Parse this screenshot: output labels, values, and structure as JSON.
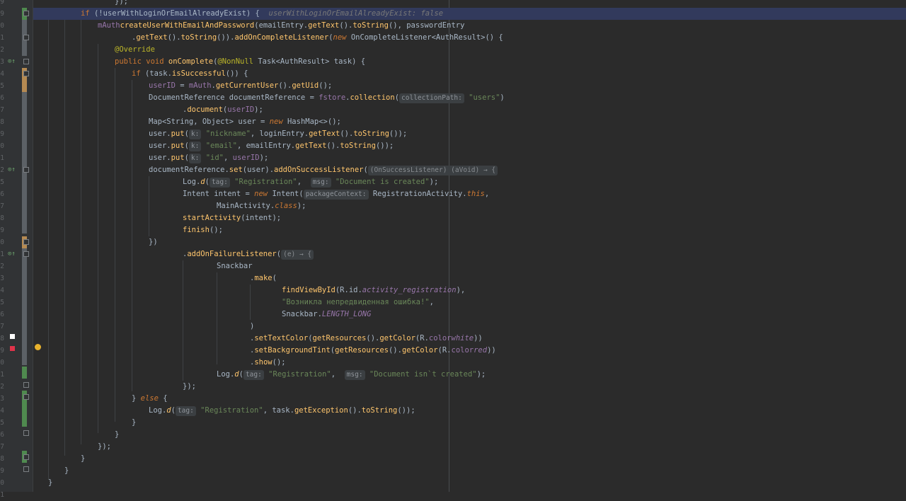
{
  "gutter": {
    "line_numbers": [
      "9",
      "9",
      "0",
      "1",
      "2",
      "3",
      "4",
      "5",
      "6",
      "7",
      "8",
      "9",
      "0",
      "1",
      "2",
      "5",
      "6",
      "7",
      "8",
      "9",
      "0",
      "1",
      "2",
      "3",
      "4",
      "5",
      "6",
      "7",
      "8",
      "9",
      "0",
      "1",
      "2",
      "3",
      "4",
      "5",
      "6",
      "7",
      "8",
      "9",
      "0",
      "1"
    ]
  },
  "colors": {
    "background": "#2b2b2b",
    "current_line": "#323a5c",
    "keyword": "#cc7832",
    "string": "#6a8759",
    "field": "#9876aa",
    "method": "#ffc66d",
    "annotation": "#bbb529",
    "swatch_white": "#ffffff",
    "swatch_red": "#e0334a"
  },
  "code": {
    "l0": "});",
    "l1": {
      "a": "if",
      "b": " (!userWithLoginOrEmailAlreadyExist) {",
      "hint": "userWithLoginOrEmailAlreadyExist: false"
    },
    "l2": {
      "a": "mAuth",
      ".": ".",
      "b": "createUserWithEmailAndPassword",
      "c": "(emailEntry.",
      "d": "getText",
      "e": "().",
      "f": "toString",
      "g": "(), passwordEntry"
    },
    "l3": {
      "a": ".",
      "b": "getText",
      "c": "().",
      "d": "toString",
      "e": "()).",
      "f": "addOnCompleteListener",
      "g": "(",
      "h": "new",
      "i": " OnCompleteListener<AuthResult>() {"
    },
    "l4": "@Override",
    "l5": {
      "a": "public void",
      "b": " ",
      "c": "onComplete",
      "d": "(",
      "e": "@NonNull",
      "f": " Task<AuthResult> task) {"
    },
    "l6": {
      "a": "if",
      "b": " (task.",
      "c": "isSuccessful",
      "d": "()) {"
    },
    "l7": {
      "a": "userID",
      "b": " = ",
      "c": "mAuth",
      "d": ".",
      "e": "getCurrentUser",
      "f": "().",
      "g": "getUid",
      "h": "();"
    },
    "l8": {
      "a": "DocumentReference documentReference = ",
      "b": "fstore",
      "c": ".",
      "d": "collection",
      "e": "(",
      "ph": "collectionPath:",
      "f": " ",
      "g": "\"users\"",
      "h": ")"
    },
    "l9": {
      "a": ".",
      "b": "document",
      "c": "(",
      "d": "userID",
      "e": ");"
    },
    "l10": {
      "a": "Map<String, Object> user = ",
      "b": "new",
      "c": " HashMap<>();"
    },
    "l11": {
      "a": "user.",
      "b": "put",
      "c": "(",
      "ph": "k:",
      "d": " ",
      "e": "\"nickname\"",
      "f": ", loginEntry.",
      "g": "getText",
      "h": "().",
      "i": "toString",
      "j": "());"
    },
    "l12": {
      "a": "user.",
      "b": "put",
      "c": "(",
      "ph": "k:",
      "d": " ",
      "e": "\"email\"",
      "f": ", emailEntry.",
      "g": "getText",
      "h": "().",
      "i": "toString",
      "j": "());"
    },
    "l13": {
      "a": "user.",
      "b": "put",
      "c": "(",
      "ph": "k:",
      "d": " ",
      "e": "\"id\"",
      "f": ", ",
      "g": "userID",
      "h": ");"
    },
    "l14": {
      "a": "documentReference.",
      "b": "set",
      "c": "(user).",
      "d": "addOnSuccessListener",
      "e": "(",
      "lam": "(OnSuccessListener) (aVoid) → {"
    },
    "l15": {
      "a": "Log.",
      "b": "d",
      "c": "(",
      "ph1": "tag:",
      "d": " ",
      "e": "\"Registration\"",
      "f": ",  ",
      "ph2": "msg:",
      "g": " ",
      "h": "\"Document is created\"",
      "i": ");"
    },
    "l16": {
      "a": "Intent intent = ",
      "b": "new",
      "c": " Intent(",
      "ph": "packageContext:",
      "d": " RegistrationActivity.",
      "e": "this",
      ",": ","
    },
    "l17": {
      "a": "MainActivity.",
      "b": "class",
      "c": ");"
    },
    "l18": {
      "a": "startActivity",
      "b": "(intent);"
    },
    "l19": {
      "a": "finish",
      "b": "();"
    },
    "l20": "})",
    "l21": {
      "a": ".",
      "b": "addOnFailureListener",
      "c": "(",
      "lam": "(e) → {"
    },
    "l22": "Snackbar",
    "l23": {
      "a": ".",
      "b": "make",
      "c": "("
    },
    "l24": {
      "a": "findViewById",
      "b": "(R.id.",
      "c": "activity_registration",
      "d": "),"
    },
    "l25": {
      "a": "\"Возникла непредвиденная ошибка!\"",
      "b": ","
    },
    "l26": {
      "a": "Snackbar.",
      "b": "LENGTH_LONG"
    },
    "l27": ")",
    "l28": {
      "a": ".",
      "b": "setTextColor",
      "c": "(",
      "d": "getResources",
      "e": "().",
      "f": "getColor",
      "g": "(R.",
      "h": "color",
      ".": ".",
      "i": "white",
      "j": "))"
    },
    "l29": {
      "a": ".",
      "b": "setBackgroundTint",
      "c": "(",
      "d": "getResources",
      "e": "().",
      "f": "getColor",
      "g": "(R.",
      "h": "color",
      ".": ".",
      "i": "red",
      "j": "))"
    },
    "l30": {
      "a": ".",
      "b": "show",
      "c": "();"
    },
    "l31": {
      "a": "Log.",
      "b": "d",
      "c": "(",
      "ph1": "tag:",
      "d": " ",
      "e": "\"Registration\"",
      "f": ",  ",
      "ph2": "msg:",
      "g": " ",
      "h": "\"Document isn`t created\"",
      "i": ");"
    },
    "l32": "});",
    "l33": {
      "a": "} ",
      "b": "else",
      "c": " {"
    },
    "l34": {
      "a": "Log.",
      "b": "d",
      "c": "(",
      "ph": "tag:",
      "d": " ",
      "e": "\"Registration\"",
      "f": ", task.",
      "g": "getException",
      "h": "().",
      "i": "toString",
      "j": "());"
    },
    "l35": "}",
    "l36": "}",
    "l37": "});",
    "l38": "}",
    "l39": "}",
    "l40": "}"
  }
}
